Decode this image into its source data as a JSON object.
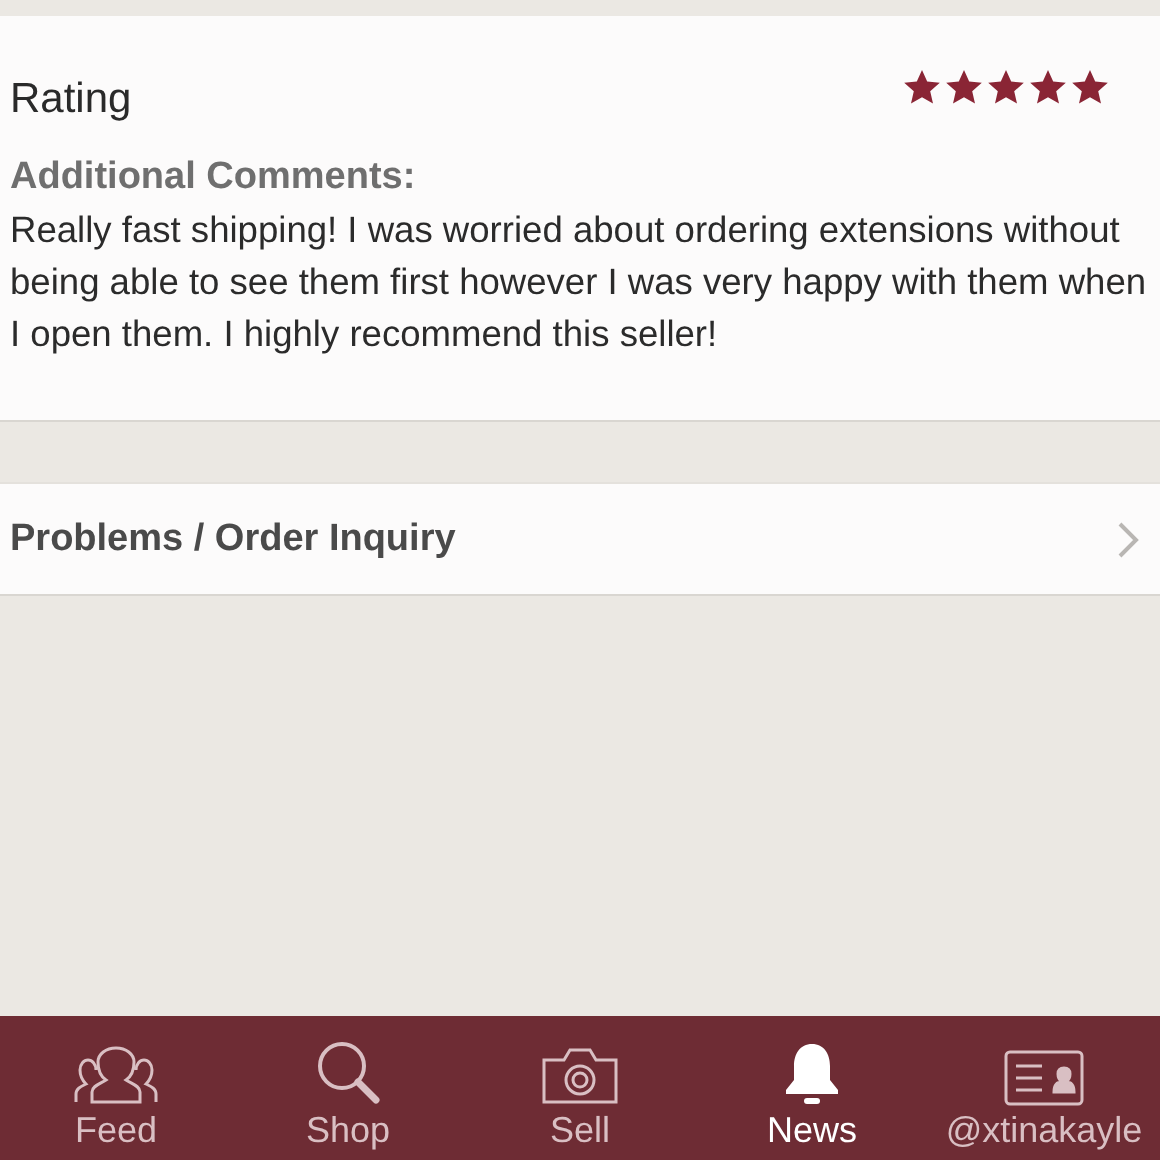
{
  "rating": {
    "label": "Rating",
    "stars": 5
  },
  "comments": {
    "label": "Additional Comments:",
    "text": "Really fast shipping! I was worried about ordering extensions without being able to see them first however I was very happy with them when I open them. I highly recommend this seller!"
  },
  "problems_link": {
    "label": "Problems / Order Inquiry"
  },
  "tab_bar": [
    {
      "kind": "feed",
      "label": "Feed",
      "selected": false
    },
    {
      "kind": "shop",
      "label": "Shop",
      "selected": false
    },
    {
      "kind": "sell",
      "label": "Sell",
      "selected": false
    },
    {
      "kind": "news",
      "label": "News",
      "selected": true
    },
    {
      "kind": "profile",
      "label": "@xtinakayle",
      "selected": false
    }
  ]
}
